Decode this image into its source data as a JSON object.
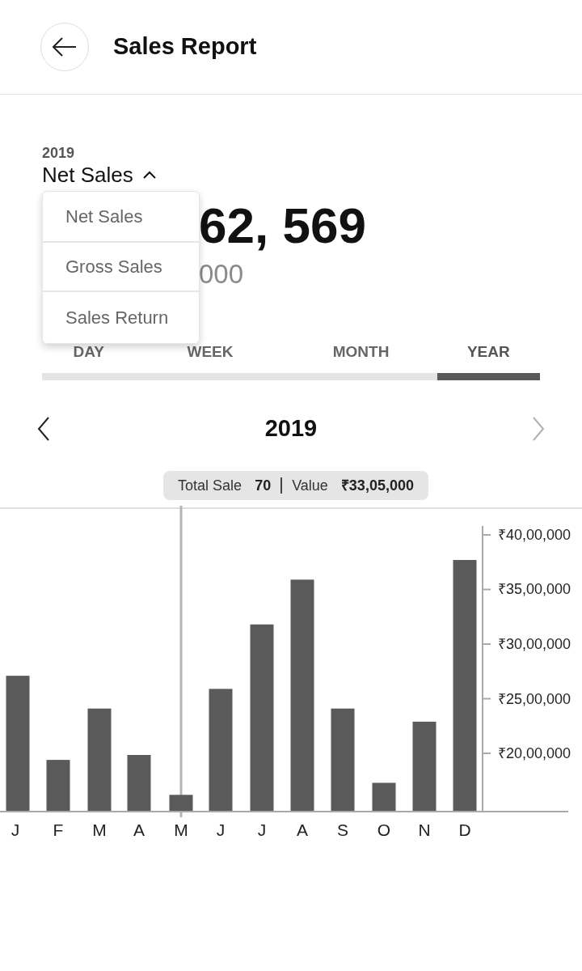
{
  "header": {
    "title": "Sales Report"
  },
  "summary": {
    "year": "2019",
    "metric": "Net Sales",
    "expanded": true,
    "amount": "62, 569",
    "sub_amount": "000"
  },
  "dropdown": {
    "items": [
      "Net Sales",
      "Gross Sales",
      "Sales Return"
    ]
  },
  "tabs": [
    {
      "label": "DAY",
      "selected": false
    },
    {
      "label": "WEEK",
      "selected": false
    },
    {
      "label": "MONTH",
      "selected": false
    },
    {
      "label": "YEAR",
      "selected": true
    }
  ],
  "period": {
    "label": "2019",
    "prev_disabled": false,
    "next_disabled": true
  },
  "tooltip": {
    "label_1": "Total Sale",
    "value_1": "70",
    "label_2": "Value",
    "value_2": "₹33,05,000"
  },
  "chart_data": {
    "type": "bar",
    "categories": [
      "J",
      "F",
      "M",
      "A",
      "M",
      "J",
      "J",
      "A",
      "S",
      "O",
      "N",
      "D"
    ],
    "series": [
      {
        "color": "#5a5a5a",
        "values": [
          2710000,
          1940000,
          2410000,
          1985000,
          1620000,
          2590000,
          3180000,
          3590000,
          2410000,
          1730000,
          2290000,
          3770000
        ]
      }
    ],
    "ylim": [
      1466667,
      4081481
    ],
    "yticks": [
      {
        "value": 2000000,
        "label": "₹20,00,000"
      },
      {
        "value": 2500000,
        "label": "₹25,00,000"
      },
      {
        "value": 3000000,
        "label": "₹30,00,000"
      },
      {
        "value": 3500000,
        "label": "₹35,00,000"
      },
      {
        "value": 4000000,
        "label": "₹40,00,000"
      }
    ]
  }
}
